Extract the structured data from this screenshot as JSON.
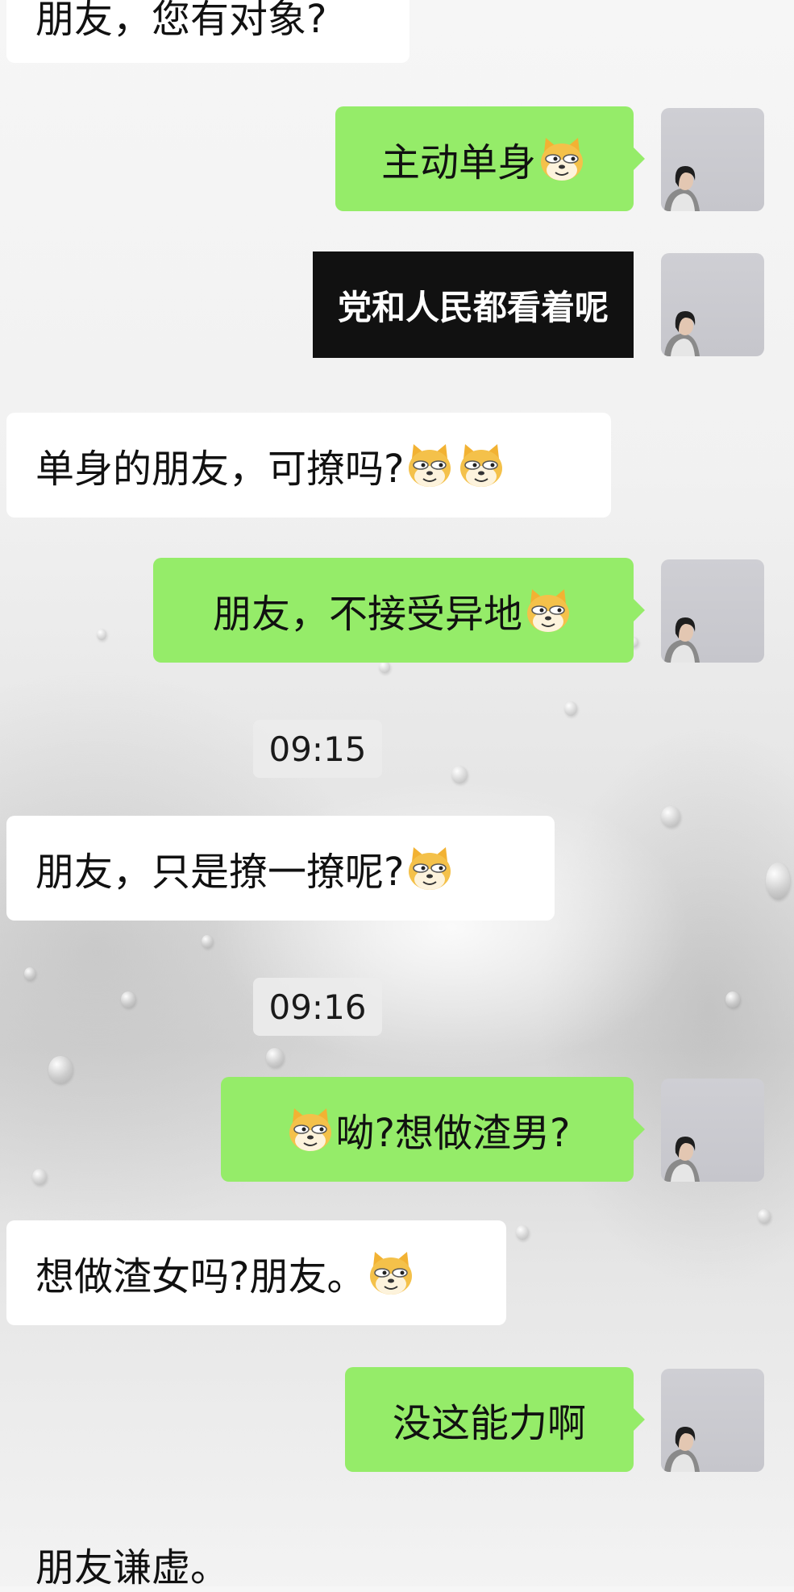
{
  "messages": [
    {
      "side": "in",
      "text": "朋友，您有对象?",
      "emoji_after": 0
    },
    {
      "side": "out",
      "text": "主动单身",
      "emoji_after": 1
    },
    {
      "side": "out-sticker",
      "text": "党和人民都看着呢"
    },
    {
      "side": "in",
      "text": "单身的朋友，可撩吗?",
      "emoji_after": 2
    },
    {
      "side": "out",
      "text": "朋友，不接受异地",
      "emoji_after": 1
    },
    {
      "side": "time",
      "text": "09:15"
    },
    {
      "side": "in",
      "text": "朋友，只是撩一撩呢?",
      "emoji_after": 1
    },
    {
      "side": "time",
      "text": "09:16"
    },
    {
      "side": "out",
      "text": "呦?想做渣男?",
      "emoji_before": 1
    },
    {
      "side": "in",
      "text": "想做渣女吗?朋友。",
      "emoji_after": 1
    },
    {
      "side": "out",
      "text": "没这能力啊"
    },
    {
      "side": "in-plain",
      "text": "朋友谦虚。"
    }
  ],
  "emoji": {
    "name": "doge-emoji"
  },
  "colors": {
    "outgoing_bubble": "#95ec69",
    "incoming_bubble": "#ffffff",
    "sticker_bg": "#111111"
  }
}
